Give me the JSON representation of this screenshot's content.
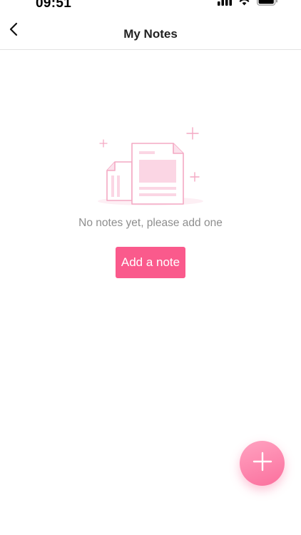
{
  "status_bar": {
    "time": "09:51"
  },
  "header": {
    "title": "My Notes",
    "back_icon": "chevron-left-icon"
  },
  "empty_state": {
    "illustration_icon": "documents-illustration-icon",
    "message": "No notes yet, please add one",
    "button_label": "Add a note"
  },
  "fab": {
    "icon": "plus-icon"
  },
  "colors": {
    "accent": "#fa5a8c",
    "illustration": "#f4a9c3",
    "muted_text": "#8e8e8e"
  }
}
